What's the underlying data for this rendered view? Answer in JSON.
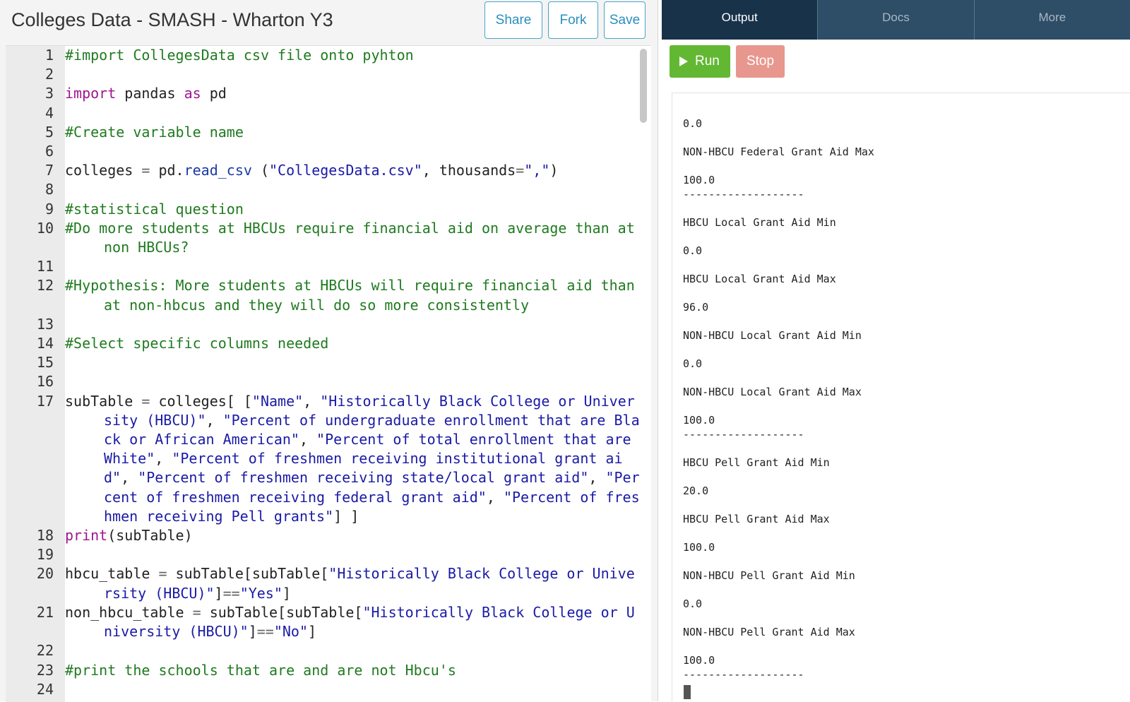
{
  "header": {
    "title": "Colleges Data - SMASH - Wharton Y3",
    "buttons": {
      "share": "Share",
      "fork": "Fork",
      "save": "Save"
    }
  },
  "editor": {
    "lines": [
      {
        "n": "1",
        "tokens": [
          {
            "t": "comment",
            "v": "#import CollegesData csv file onto pyhton"
          }
        ]
      },
      {
        "n": "2",
        "tokens": []
      },
      {
        "n": "3",
        "tokens": [
          {
            "t": "kw",
            "v": "import"
          },
          {
            "t": "plain",
            "v": " pandas "
          },
          {
            "t": "kw",
            "v": "as"
          },
          {
            "t": "plain",
            "v": " pd"
          }
        ]
      },
      {
        "n": "4",
        "tokens": []
      },
      {
        "n": "5",
        "tokens": [
          {
            "t": "comment",
            "v": "#Create variable name"
          }
        ]
      },
      {
        "n": "6",
        "tokens": []
      },
      {
        "n": "7",
        "tokens": [
          {
            "t": "plain",
            "v": "colleges "
          },
          {
            "t": "op",
            "v": "="
          },
          {
            "t": "plain",
            "v": " pd."
          },
          {
            "t": "attr",
            "v": "read_csv"
          },
          {
            "t": "plain",
            "v": " ("
          },
          {
            "t": "str",
            "v": "\"CollegesData.csv\""
          },
          {
            "t": "plain",
            "v": ", thousands"
          },
          {
            "t": "op",
            "v": "="
          },
          {
            "t": "str",
            "v": "\",\""
          },
          {
            "t": "plain",
            "v": ")"
          }
        ]
      },
      {
        "n": "8",
        "tokens": []
      },
      {
        "n": "9",
        "tokens": [
          {
            "t": "comment",
            "v": "#statistical question"
          }
        ]
      },
      {
        "n": "10",
        "tokens": [
          {
            "t": "comment",
            "v": "#Do more students at HBCUs require financial aid on average than at non HBCUs?"
          }
        ]
      },
      {
        "n": "11",
        "tokens": []
      },
      {
        "n": "12",
        "tokens": [
          {
            "t": "comment",
            "v": "#Hypothesis: More students at HBCUs will require financial aid than at non-hbcus and they will do so more consistently"
          }
        ]
      },
      {
        "n": "13",
        "tokens": []
      },
      {
        "n": "14",
        "tokens": [
          {
            "t": "comment",
            "v": "#Select specific columns needed"
          }
        ]
      },
      {
        "n": "15",
        "tokens": []
      },
      {
        "n": "16",
        "tokens": []
      },
      {
        "n": "17",
        "tokens": [
          {
            "t": "plain",
            "v": "subTable "
          },
          {
            "t": "op",
            "v": "="
          },
          {
            "t": "plain",
            "v": " colleges[ ["
          },
          {
            "t": "str",
            "v": "\"Name\""
          },
          {
            "t": "plain",
            "v": ", "
          },
          {
            "t": "str",
            "v": "\"Historically Black College or University (HBCU)\""
          },
          {
            "t": "plain",
            "v": ", "
          },
          {
            "t": "str",
            "v": "\"Percent of undergraduate enrollment that are Black or African American\""
          },
          {
            "t": "plain",
            "v": ", "
          },
          {
            "t": "str",
            "v": "\"Percent of total enrollment that are White\""
          },
          {
            "t": "plain",
            "v": ", "
          },
          {
            "t": "str",
            "v": "\"Percent of freshmen receiving institutional grant aid\""
          },
          {
            "t": "plain",
            "v": ", "
          },
          {
            "t": "str",
            "v": "\"Percent of freshmen receiving state/local grant aid\""
          },
          {
            "t": "plain",
            "v": ", "
          },
          {
            "t": "str",
            "v": "\"Percent of freshmen receiving federal grant aid\""
          },
          {
            "t": "plain",
            "v": ", "
          },
          {
            "t": "str",
            "v": "\"Percent of freshmen receiving Pell grants\""
          },
          {
            "t": "plain",
            "v": "] ]"
          }
        ]
      },
      {
        "n": "18",
        "tokens": [
          {
            "t": "kw",
            "v": "print"
          },
          {
            "t": "plain",
            "v": "(subTable)"
          }
        ]
      },
      {
        "n": "19",
        "tokens": []
      },
      {
        "n": "20",
        "tokens": [
          {
            "t": "plain",
            "v": "hbcu_table "
          },
          {
            "t": "op",
            "v": "="
          },
          {
            "t": "plain",
            "v": " subTable[subTable["
          },
          {
            "t": "str",
            "v": "\"Historically Black College or University (HBCU)\""
          },
          {
            "t": "plain",
            "v": "]"
          },
          {
            "t": "op",
            "v": "=="
          },
          {
            "t": "str",
            "v": "\"Yes\""
          },
          {
            "t": "plain",
            "v": "]"
          }
        ]
      },
      {
        "n": "21",
        "tokens": [
          {
            "t": "plain",
            "v": "non_hbcu_table "
          },
          {
            "t": "op",
            "v": "="
          },
          {
            "t": "plain",
            "v": " subTable[subTable["
          },
          {
            "t": "str",
            "v": "\"Historically Black College or University (HBCU)\""
          },
          {
            "t": "plain",
            "v": "]"
          },
          {
            "t": "op",
            "v": "=="
          },
          {
            "t": "str",
            "v": "\"No\""
          },
          {
            "t": "plain",
            "v": "]"
          }
        ]
      },
      {
        "n": "22",
        "tokens": []
      },
      {
        "n": "23",
        "tokens": [
          {
            "t": "comment",
            "v": "#print the schools that are and are not Hbcu's"
          }
        ]
      },
      {
        "n": "24",
        "tokens": []
      }
    ]
  },
  "right_panel": {
    "tabs": [
      {
        "label": "Output",
        "active": true
      },
      {
        "label": "Docs",
        "active": false
      },
      {
        "label": "More",
        "active": false
      }
    ],
    "run_label": "Run",
    "stop_label": "Stop",
    "console_lines": [
      {
        "text": "0.0",
        "kind": "value"
      },
      {
        "text": "NON-HBCU Federal Grant Aid Max",
        "kind": "label"
      },
      {
        "text": "100.0",
        "kind": "value"
      },
      {
        "text": "-------------------",
        "kind": "sep"
      },
      {
        "text": "HBCU Local Grant Aid Min",
        "kind": "label"
      },
      {
        "text": "0.0",
        "kind": "value"
      },
      {
        "text": "HBCU Local Grant Aid Max",
        "kind": "label"
      },
      {
        "text": "96.0",
        "kind": "value"
      },
      {
        "text": "NON-HBCU Local Grant Aid Min",
        "kind": "label"
      },
      {
        "text": "0.0",
        "kind": "value"
      },
      {
        "text": "NON-HBCU Local Grant Aid Max",
        "kind": "label"
      },
      {
        "text": "100.0",
        "kind": "value"
      },
      {
        "text": "-------------------",
        "kind": "sep"
      },
      {
        "text": "HBCU Pell Grant Aid Min",
        "kind": "label"
      },
      {
        "text": "20.0",
        "kind": "value"
      },
      {
        "text": "HBCU Pell Grant Aid Max",
        "kind": "label"
      },
      {
        "text": "100.0",
        "kind": "value"
      },
      {
        "text": "NON-HBCU Pell Grant Aid Min",
        "kind": "label"
      },
      {
        "text": "0.0",
        "kind": "value"
      },
      {
        "text": "NON-HBCU Pell Grant Aid Max",
        "kind": "label"
      },
      {
        "text": "100.0",
        "kind": "value"
      },
      {
        "text": "-------------------",
        "kind": "sep"
      }
    ]
  },
  "colors": {
    "tab_active_bg": "#18324a",
    "tab_bg": "#2e4d66",
    "run_green": "#63b833",
    "stop_red": "#e8978e",
    "button_blue": "#2a8fc0"
  }
}
